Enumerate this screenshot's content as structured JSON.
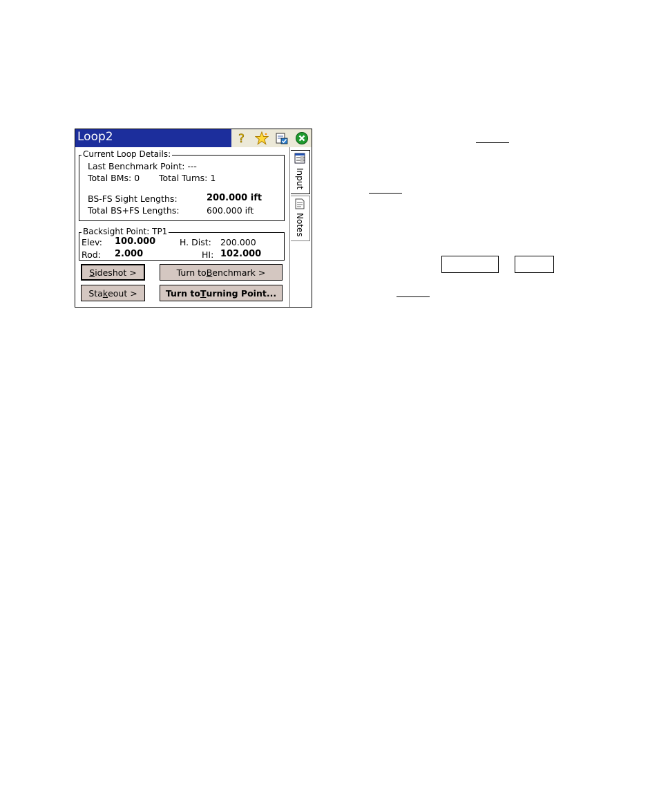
{
  "window": {
    "title": "Loop2",
    "titlebar_icons": [
      "help-icon",
      "star-icon",
      "task-icon",
      "close-icon"
    ]
  },
  "current_loop": {
    "legend": "Current Loop Details:",
    "last_bm_label": "Last Benchmark Point: ---",
    "total_bms": "Total BMs: 0",
    "total_turns": "Total Turns: 1",
    "bsfs_sight_label": "BS-FS Sight Lengths:",
    "bsfs_sight_value": "200.000 ift",
    "total_bsfs_label": "Total BS+FS Lengths:",
    "total_bsfs_value": "600.000 ift"
  },
  "backsight": {
    "legend": "Backsight Point: TP1",
    "elev_label": "Elev:",
    "elev_value": "100.000",
    "hdist_label": "H. Dist:",
    "hdist_value": "200.000",
    "rod_label": "Rod:",
    "rod_value": "2.000",
    "hi_label": "HI:",
    "hi_value": "102.000"
  },
  "buttons": {
    "sideshot_pre": "",
    "sideshot_u": "S",
    "sideshot_post": "ideshot >",
    "turn_bm_pre": "Turn to ",
    "turn_bm_u": "B",
    "turn_bm_post": "enchmark >",
    "stakeout_pre": "Sta",
    "stakeout_u": "k",
    "stakeout_post": "eout >",
    "turn_tp_pre": "Turn to ",
    "turn_tp_u": "T",
    "turn_tp_post": "urning Point..."
  },
  "tabs": {
    "input": "Input",
    "notes": "Notes"
  }
}
